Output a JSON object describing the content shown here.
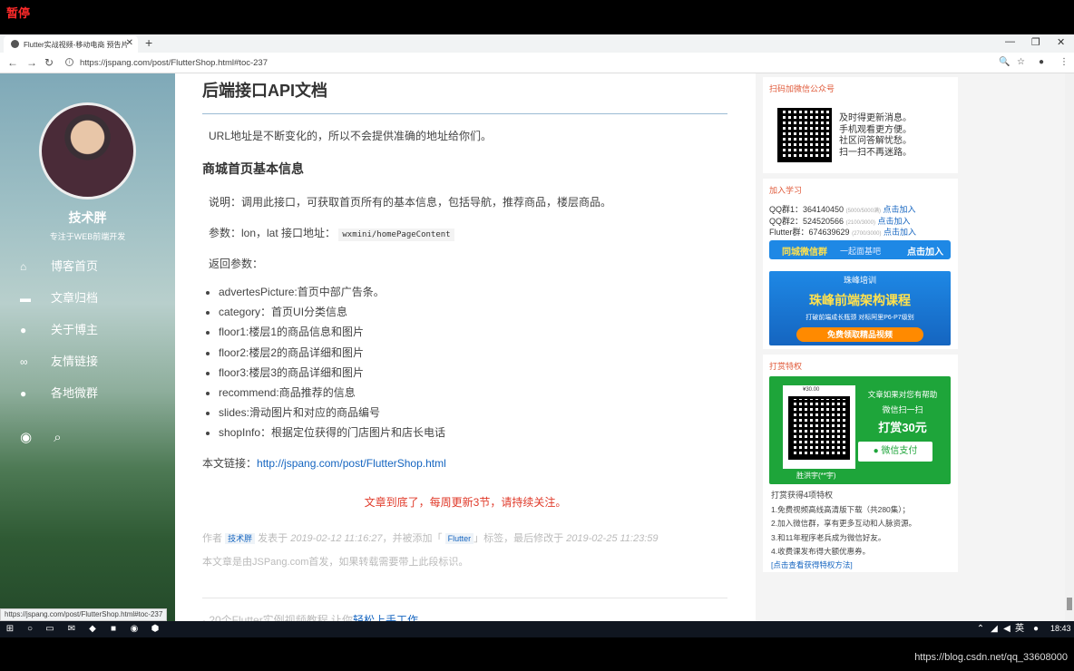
{
  "overlay": {
    "pause_label": "暂停"
  },
  "browser": {
    "tab_title": "Flutter实战视频-移动电商 预告片",
    "url": "https://jspang.com/post/FlutterShop.html#toc-237",
    "status_url": "https://jspang.com/post/FlutterShop.html#toc-237"
  },
  "sidebar": {
    "name": "技术胖",
    "desc": "专注于WEB前端开发",
    "items": [
      {
        "label": "博客首页",
        "icon": "home-icon"
      },
      {
        "label": "文章归档",
        "icon": "archive-icon"
      },
      {
        "label": "关于博主",
        "icon": "user-icon"
      },
      {
        "label": "友情链接",
        "icon": "link-icon"
      },
      {
        "label": "各地微群",
        "icon": "user-icon"
      }
    ]
  },
  "article": {
    "heading": "后端接口API文档",
    "intro": "URL地址是不断变化的，所以不会提供准确的地址给你们。",
    "section_title": "商城首页基本信息",
    "desc": "说明：调用此接口，可获取首页所有的基本信息，包括导航，推荐商品，楼层商品。",
    "params_label": "参数：lon，lat 接口地址：",
    "params_code": "wxmini/homePageContent",
    "return_label": "返回参数：",
    "return_params": [
      "advertesPicture:首页中部广告条。",
      "category：首页UI分类信息",
      "floor1:楼层1的商品信息和图片",
      "floor2:楼层2的商品详细和图片",
      "floor3:楼层3的商品详细和图片",
      "recommend:商品推荐的信息",
      "slides:滑动图片和对应的商品编号",
      "shopInfo：根据定位获得的门店图片和店长电话"
    ],
    "permalink_label": "本文链接：",
    "permalink": "http://jspang.com/post/FlutterShop.html",
    "end_note": "文章到底了，每周更新3节，请持续关注。",
    "meta_author_label": "作者",
    "meta_author": "技术胖",
    "meta_published": "发表于",
    "meta_publish_time": "2019-02-12 11:16:27",
    "meta_tag_prefix": "，并被添加「",
    "meta_tag": "Flutter",
    "meta_tag_suffix": "」标签，最后修改于",
    "meta_modified_time": "2019-02-25 11:23:59",
    "copyright": "本文章是由JSPang.com首发，如果转载需要带上此段标识。",
    "next_prefix": "· 20个Flutter实例视频教程 让你",
    "next_link": "轻松上手工作"
  },
  "right": {
    "wechat_title": "扫码加微信公众号",
    "wechat_lines": [
      "及时得更新消息。",
      "手机观看更方便。",
      "社区问答解忧愁。",
      "扫一扫不再迷路。"
    ],
    "join_title": "加入学习",
    "groups": [
      {
        "label": "QQ群1：",
        "number": "364140450",
        "count": "(5000/5000满)",
        "action": "点击加入"
      },
      {
        "label": "QQ群2：",
        "number": "524520566",
        "count": "(2100/3000)",
        "action": "点击加入"
      },
      {
        "label": "Flutter群：",
        "number": "674639629",
        "count": "(2700/3000)",
        "action": "点击加入"
      }
    ],
    "banner1_left": "同城微信群",
    "banner1_mid": "一起面基吧",
    "banner1_right": "点击加入",
    "banner2_logo": "珠峰培训",
    "banner2_title": "珠峰前端架构课程",
    "banner2_sub": "打破前端成长瓶颈 对标阿里P6-P7级别",
    "banner2_btn": "免费领取精品视频",
    "reward_title": "打赏特权",
    "pay_price": "¥30.00",
    "pay_line1": "文章如果对您有帮助",
    "pay_line2": "微信扫一扫",
    "pay_line3": "打赏30元",
    "pay_button": "微信支付",
    "pay_name": "胜洪宇(**宇)",
    "reward_heading": "打赏获得4项特权",
    "reward_items": [
      "1.免费视频高线高清版下载（共280集）；",
      "2.加入微信群，享有更多互动和人脉资源。",
      "3.和11年程序老兵成为微信好友。",
      "4.收费课发布得大额优惠券。"
    ],
    "reward_link": "[点击查看获得特权方法]"
  },
  "taskbar": {
    "ime": "英",
    "clock": "18:43"
  },
  "watermark": "https://blog.csdn.net/qq_33608000"
}
